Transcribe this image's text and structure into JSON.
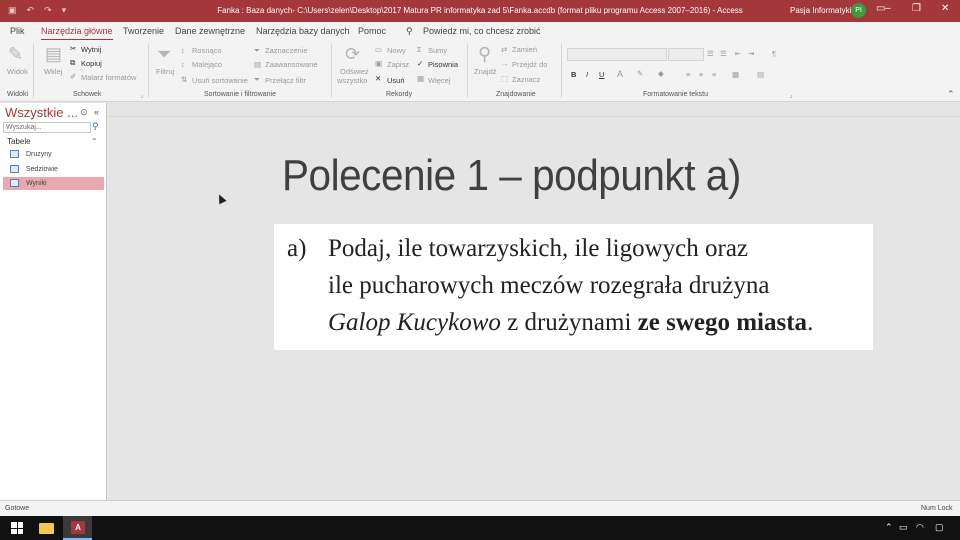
{
  "titlebar": {
    "title": "Fanka : Baza danych- C:\\Users\\zelen\\Desktop\\2017 Matura PR informatyka zad 5\\Fanka.accdb (format pliku programu Access 2007–2016)  -  Access",
    "user": "Pasja Informatyki",
    "avatar": "PI",
    "qat_icons": [
      "save-icon",
      "undo-icon",
      "redo-icon",
      "customize-icon"
    ],
    "window_controls": [
      "minimize-icon",
      "restore-icon",
      "close-icon"
    ]
  },
  "menu": {
    "tabs": [
      "Plik",
      "Narzędzia główne",
      "Tworzenie",
      "Dane zewnętrzne",
      "Narzędzia bazy danych",
      "Pomoc"
    ],
    "active": "Narzędzia główne",
    "tell_me": "Powiedz mi, co chcesz zrobić"
  },
  "ribbon": {
    "widok": "Widok",
    "wklej": "Wklej",
    "wytnij": "Wytnij",
    "kopiuj": "Kopiuj",
    "malarz": "Malarz formatów",
    "filtruj": "Filtruj",
    "rosnaco": "Rosnąco",
    "malejaco": "Malejąco",
    "usun_sortowanie": "Usuń sortowanie",
    "zaznaczenie": "Zaznaczenie",
    "zaawansowane": "Zaawansowane",
    "przelacz_filtr": "Przełącz filtr",
    "odswiez": "Odśwież",
    "wszystko": "wszystko",
    "nowy": "Nowy",
    "zapisz": "Zapisz",
    "usun": "Usuń",
    "sumy": "Sumy",
    "pisownia": "Pisownia",
    "wiecej": "Więcej",
    "znajdz": "Znajdź",
    "zamien": "Zamień",
    "przejdz_do": "Przejdź do",
    "zaznacz": "Zaznacz",
    "groups": [
      "Widoki",
      "Schowek",
      "Sortowanie i filtrowanie",
      "Rekordy",
      "Znajdowanie",
      "Formatowanie tekstu"
    ]
  },
  "nav": {
    "title": "Wszystkie ...",
    "search_placeholder": "Wyszukaj...",
    "section": "Tabele",
    "tables": [
      "Druzyny",
      "Sedziowie",
      "Wyniki"
    ],
    "selected": "Wyniki"
  },
  "slide": {
    "title": "Polecenie 1 – podpunkt a)",
    "letter": "a)",
    "line1": "Podaj, ile towarzyskich, ile ligowych oraz",
    "line2": "ile pucharowych meczów rozegrała drużyna",
    "line3_italic": "Galop Kucykowo",
    "line3_mid": " z drużynami ",
    "line3_bold": "ze swego miasta",
    "line3_end": "."
  },
  "status": {
    "left": "Gotowe",
    "right": "Num Lock"
  }
}
